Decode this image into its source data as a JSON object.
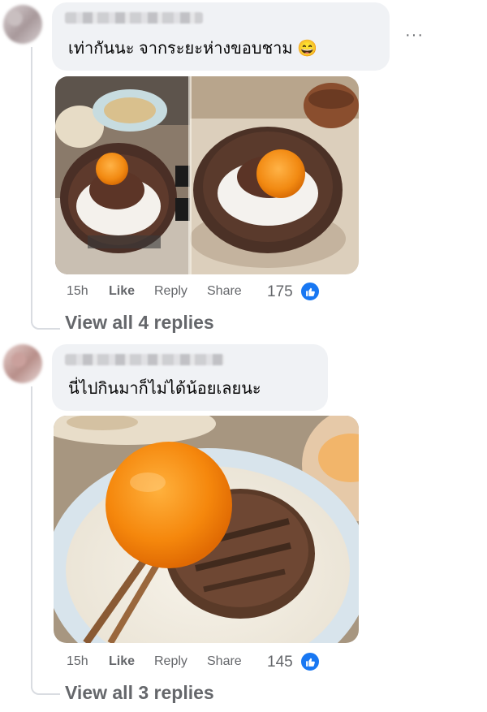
{
  "comments": [
    {
      "text": "เท่ากันนะ จากระยะห่างขอบชาม",
      "emoji": "😄",
      "time": "15h",
      "like_label": "Like",
      "reply_label": "Reply",
      "share_label": "Share",
      "reaction_count": "175",
      "view_replies": "View all 4 replies"
    },
    {
      "text": "นี่ไปกินมาก็ไม่ได้น้อยเลยนะ",
      "time": "15h",
      "like_label": "Like",
      "reply_label": "Reply",
      "share_label": "Share",
      "reaction_count": "145",
      "view_replies": "View all 3 replies"
    }
  ],
  "menu_glyph": "···",
  "colors": {
    "bubble": "#f0f2f5",
    "like_blue": "#1877f2",
    "meta_gray": "#65676b"
  },
  "icons": [
    "more-options-icon",
    "thumbs-up-icon",
    "laugh-emoji-icon"
  ]
}
